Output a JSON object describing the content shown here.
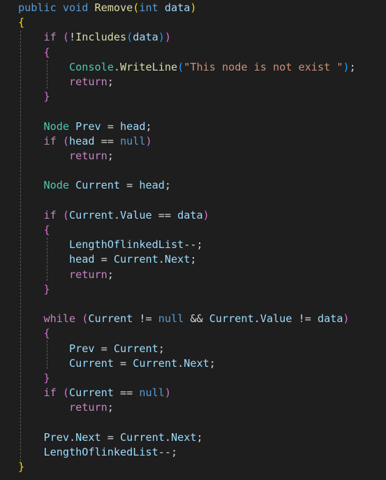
{
  "editor": {
    "background": "#1e1e1e",
    "colors": {
      "keyword": "#569cd6",
      "control": "#c586c0",
      "type": "#4ec9b0",
      "function": "#dcdcaa",
      "variable": "#9cdcfe",
      "string": "#ce9178",
      "text": "#d4d4d4",
      "bracket1": "#ffd700",
      "bracket2": "#da70d6",
      "bracket3": "#179fff"
    },
    "lines": [
      [
        [
          "kw",
          "public "
        ],
        [
          "kw",
          "void "
        ],
        [
          "fn",
          "Remove"
        ],
        [
          "brk",
          "("
        ],
        [
          "kw",
          "int "
        ],
        [
          "var",
          "data"
        ],
        [
          "brk",
          ")"
        ]
      ],
      [
        [
          "brk",
          "{"
        ]
      ],
      [
        [
          "txt",
          "    "
        ],
        [
          "ctl",
          "if "
        ],
        [
          "brk2",
          "("
        ],
        [
          "txt",
          "!"
        ],
        [
          "fn",
          "Includes"
        ],
        [
          "brk3",
          "("
        ],
        [
          "var",
          "data"
        ],
        [
          "brk3",
          ")"
        ],
        [
          "brk2",
          ")"
        ]
      ],
      [
        [
          "txt",
          "    "
        ],
        [
          "brk2",
          "{"
        ]
      ],
      [
        [
          "txt",
          "        "
        ],
        [
          "type",
          "Console"
        ],
        [
          "txt",
          "."
        ],
        [
          "fn",
          "WriteLine"
        ],
        [
          "brk3",
          "("
        ],
        [
          "str",
          "\"This node is not exist \""
        ],
        [
          "brk3",
          ")"
        ],
        [
          "txt",
          ";"
        ]
      ],
      [
        [
          "txt",
          "        "
        ],
        [
          "ctl",
          "return"
        ],
        [
          "txt",
          ";"
        ]
      ],
      [
        [
          "txt",
          "    "
        ],
        [
          "brk2",
          "}"
        ]
      ],
      [],
      [
        [
          "txt",
          "    "
        ],
        [
          "type",
          "Node "
        ],
        [
          "var",
          "Prev"
        ],
        [
          "txt",
          " = "
        ],
        [
          "var",
          "head"
        ],
        [
          "txt",
          ";"
        ]
      ],
      [
        [
          "txt",
          "    "
        ],
        [
          "ctl",
          "if "
        ],
        [
          "brk2",
          "("
        ],
        [
          "var",
          "head"
        ],
        [
          "txt",
          " == "
        ],
        [
          "kw",
          "null"
        ],
        [
          "brk2",
          ")"
        ]
      ],
      [
        [
          "txt",
          "        "
        ],
        [
          "ctl",
          "return"
        ],
        [
          "txt",
          ";"
        ]
      ],
      [],
      [
        [
          "txt",
          "    "
        ],
        [
          "type",
          "Node "
        ],
        [
          "var",
          "Current"
        ],
        [
          "txt",
          " = "
        ],
        [
          "var",
          "head"
        ],
        [
          "txt",
          ";"
        ]
      ],
      [],
      [
        [
          "txt",
          "    "
        ],
        [
          "ctl",
          "if "
        ],
        [
          "brk2",
          "("
        ],
        [
          "var",
          "Current"
        ],
        [
          "txt",
          "."
        ],
        [
          "var",
          "Value"
        ],
        [
          "txt",
          " == "
        ],
        [
          "var",
          "data"
        ],
        [
          "brk2",
          ")"
        ]
      ],
      [
        [
          "txt",
          "    "
        ],
        [
          "brk2",
          "{"
        ]
      ],
      [
        [
          "txt",
          "        "
        ],
        [
          "var",
          "LengthOflinkedList"
        ],
        [
          "txt",
          "--;"
        ]
      ],
      [
        [
          "txt",
          "        "
        ],
        [
          "var",
          "head"
        ],
        [
          "txt",
          " = "
        ],
        [
          "var",
          "Current"
        ],
        [
          "txt",
          "."
        ],
        [
          "var",
          "Next"
        ],
        [
          "txt",
          ";"
        ]
      ],
      [
        [
          "txt",
          "        "
        ],
        [
          "ctl",
          "return"
        ],
        [
          "txt",
          ";"
        ]
      ],
      [
        [
          "txt",
          "    "
        ],
        [
          "brk2",
          "}"
        ]
      ],
      [],
      [
        [
          "txt",
          "    "
        ],
        [
          "ctl",
          "while "
        ],
        [
          "brk2",
          "("
        ],
        [
          "var",
          "Current"
        ],
        [
          "txt",
          " != "
        ],
        [
          "kw",
          "null"
        ],
        [
          "txt",
          " && "
        ],
        [
          "var",
          "Current"
        ],
        [
          "txt",
          "."
        ],
        [
          "var",
          "Value"
        ],
        [
          "txt",
          " != "
        ],
        [
          "var",
          "data"
        ],
        [
          "brk2",
          ")"
        ]
      ],
      [
        [
          "txt",
          "    "
        ],
        [
          "brk2",
          "{"
        ]
      ],
      [
        [
          "txt",
          "        "
        ],
        [
          "var",
          "Prev"
        ],
        [
          "txt",
          " = "
        ],
        [
          "var",
          "Current"
        ],
        [
          "txt",
          ";"
        ]
      ],
      [
        [
          "txt",
          "        "
        ],
        [
          "var",
          "Current"
        ],
        [
          "txt",
          " = "
        ],
        [
          "var",
          "Current"
        ],
        [
          "txt",
          "."
        ],
        [
          "var",
          "Next"
        ],
        [
          "txt",
          ";"
        ]
      ],
      [
        [
          "txt",
          "    "
        ],
        [
          "brk2",
          "}"
        ]
      ],
      [
        [
          "txt",
          "    "
        ],
        [
          "ctl",
          "if "
        ],
        [
          "brk2",
          "("
        ],
        [
          "var",
          "Current"
        ],
        [
          "txt",
          " == "
        ],
        [
          "kw",
          "null"
        ],
        [
          "brk2",
          ")"
        ]
      ],
      [
        [
          "txt",
          "        "
        ],
        [
          "ctl",
          "return"
        ],
        [
          "txt",
          ";"
        ]
      ],
      [],
      [
        [
          "txt",
          "    "
        ],
        [
          "var",
          "Prev"
        ],
        [
          "txt",
          "."
        ],
        [
          "var",
          "Next"
        ],
        [
          "txt",
          " = "
        ],
        [
          "var",
          "Current"
        ],
        [
          "txt",
          "."
        ],
        [
          "var",
          "Next"
        ],
        [
          "txt",
          ";"
        ]
      ],
      [
        [
          "txt",
          "    "
        ],
        [
          "var",
          "LengthOflinkedList"
        ],
        [
          "txt",
          "--;"
        ]
      ],
      [
        [
          "brk",
          "}"
        ]
      ]
    ]
  }
}
